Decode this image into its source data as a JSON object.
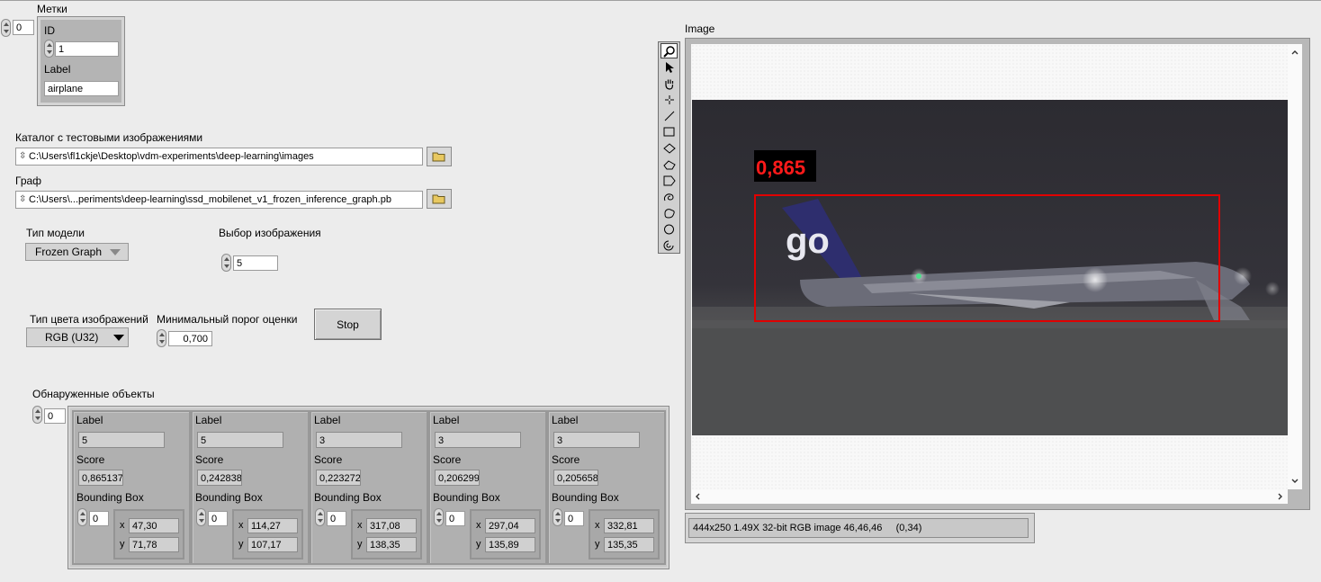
{
  "labels_cluster": {
    "title": "Метки",
    "index": "0",
    "id_label": "ID",
    "id_value": "1",
    "label_label": "Label",
    "label_value": "airplane"
  },
  "catalog": {
    "label": "Каталог с тестовыми изображениями",
    "path": "C:\\Users\\fl1ckje\\Desktop\\vdm-experiments\\deep-learning\\images"
  },
  "graph": {
    "label": "Граф",
    "path": "C:\\Users\\...periments\\deep-learning\\ssd_mobilenet_v1_frozen_inference_graph.pb"
  },
  "model_type": {
    "label": "Тип модели",
    "value": "Frozen Graph"
  },
  "image_select": {
    "label": "Выбор изображения",
    "value": "5"
  },
  "color_type": {
    "label": "Тип цвета изображений",
    "value": "RGB (U32)"
  },
  "min_threshold": {
    "label": "Минимальный порог оценки",
    "value": "0,700"
  },
  "stop_button": {
    "label": "Stop"
  },
  "detected": {
    "label": "Обнаруженные объекты",
    "index": "0",
    "label_caption": "Label",
    "score_caption": "Score",
    "bbox_caption": "Bounding Box",
    "items": [
      {
        "label": "5",
        "score": "0,865137",
        "bb_index": "0",
        "x": "47,30",
        "y": "71,78"
      },
      {
        "label": "5",
        "score": "0,242838",
        "bb_index": "0",
        "x": "114,27",
        "y": "107,17"
      },
      {
        "label": "3",
        "score": "0,223272",
        "bb_index": "0",
        "x": "317,08",
        "y": "138,35"
      },
      {
        "label": "3",
        "score": "0,206299",
        "bb_index": "0",
        "x": "297,04",
        "y": "135,89"
      },
      {
        "label": "3",
        "score": "0,205658",
        "bb_index": "0",
        "x": "332,81",
        "y": "135,35"
      }
    ]
  },
  "image_display": {
    "label": "Image",
    "score_overlay": "0,865",
    "livery_text": "go",
    "status": "444x250 1.49X 32-bit RGB image 46,46,46     (0,34)"
  },
  "toolbar_tools": [
    "zoom-icon",
    "pointer-icon",
    "pan-hand-icon",
    "point-icon",
    "line-icon",
    "rectangle-icon",
    "rotated-rectangle-icon",
    "annulus-icon",
    "polygon-icon",
    "freehand-icon",
    "freehand-region-icon",
    "oval-icon",
    "annulus-arc-icon"
  ],
  "colors": {
    "bbox": "#e00000",
    "overlay_text": "#ff1a1a"
  }
}
